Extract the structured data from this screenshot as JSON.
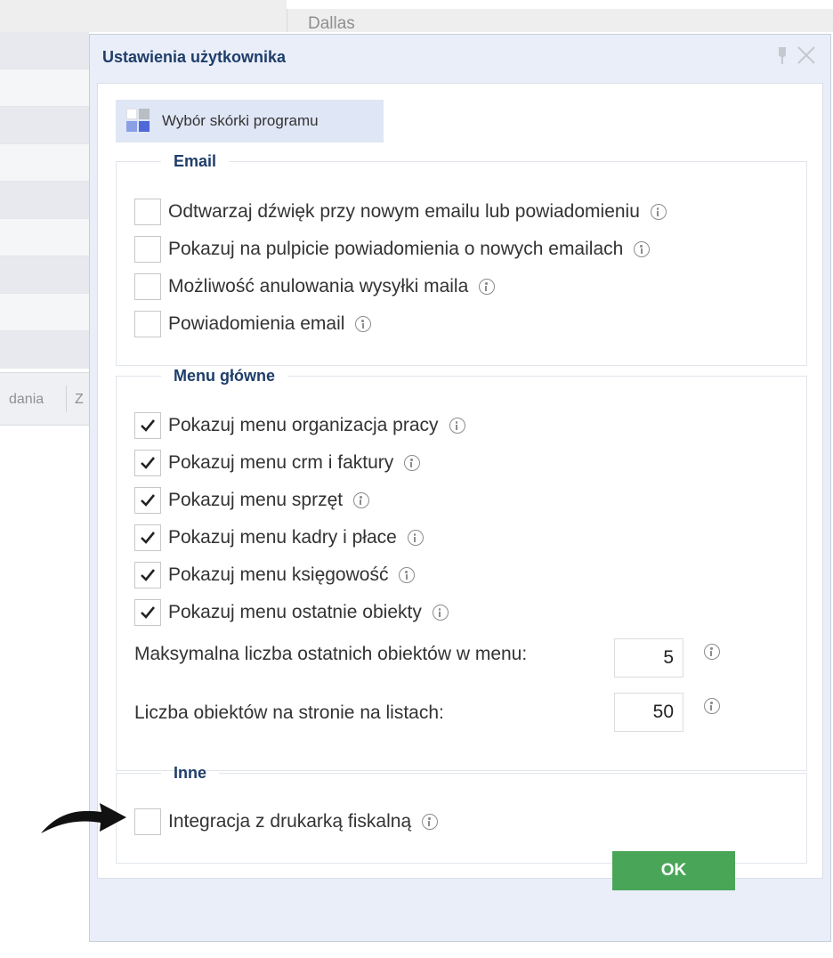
{
  "background": {
    "city": "Dallas",
    "column_headers": [
      "dania",
      "Z"
    ]
  },
  "dialog": {
    "title": "Ustawienia użytkownika",
    "icons": {
      "pin": "pin-icon",
      "close": "close-icon"
    },
    "skin_button": {
      "label": "Wybór skórki programu",
      "icon": "palette-icon"
    },
    "email_group": {
      "legend": "Email",
      "items": [
        {
          "label": "Odtwarzaj dźwięk przy nowym emailu lub powiadomieniu",
          "checked": false
        },
        {
          "label": "Pokazuj na pulpicie powiadomienia o nowych emailach",
          "checked": false
        },
        {
          "label": "Możliwość anulowania wysyłki maila",
          "checked": false
        },
        {
          "label": "Powiadomienia email",
          "checked": false
        }
      ]
    },
    "menu_group": {
      "legend": "Menu główne",
      "items": [
        {
          "label": "Pokazuj menu organizacja pracy",
          "checked": true
        },
        {
          "label": "Pokazuj menu crm i faktury",
          "checked": true
        },
        {
          "label": "Pokazuj menu sprzęt",
          "checked": true
        },
        {
          "label": "Pokazuj menu kadry i płace",
          "checked": true
        },
        {
          "label": "Pokazuj menu księgowość",
          "checked": true
        },
        {
          "label": "Pokazuj menu ostatnie obiekty",
          "checked": true
        }
      ],
      "max_recent": {
        "label": "Maksymalna liczba ostatnich obiektów w menu:",
        "value": "5"
      },
      "per_page": {
        "label": "Liczba obiektów na stronie na listach:",
        "value": "50"
      }
    },
    "other_group": {
      "legend": "Inne",
      "items": [
        {
          "label": "Integracja z drukarką fiskalną",
          "checked": false
        }
      ]
    },
    "ok_label": "OK"
  },
  "colors": {
    "title": "#1f3e6a",
    "dialog_bg": "#e9eef8",
    "ok_button": "#49a557",
    "skin_button_bg": "#dfe6f5"
  }
}
